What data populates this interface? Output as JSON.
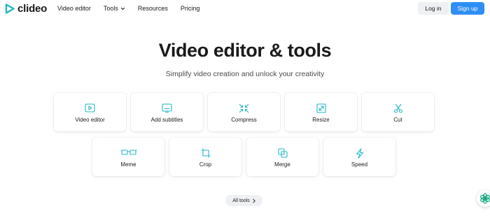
{
  "brand": {
    "name": "clideo",
    "accent": "#2f8ef4",
    "logo_teal": "#22b8c6"
  },
  "nav": {
    "items": [
      {
        "label": "Video editor"
      },
      {
        "label": "Tools",
        "icon": "chevron-down-icon"
      },
      {
        "label": "Resources"
      },
      {
        "label": "Pricing"
      }
    ],
    "login_label": "Log in",
    "signup_label": "Sign up"
  },
  "hero": {
    "title": "Video editor & tools",
    "subtitle": "Simplify video creation and unlock your creativity"
  },
  "tools": [
    {
      "label": "Video editor",
      "icon": "play-icon"
    },
    {
      "label": "Add subtitles",
      "icon": "subtitles-icon"
    },
    {
      "label": "Compress",
      "icon": "compress-icon"
    },
    {
      "label": "Resize",
      "icon": "resize-icon"
    },
    {
      "label": "Cut",
      "icon": "scissors-icon"
    },
    {
      "label": "Meme",
      "icon": "glasses-icon"
    },
    {
      "label": "Crop",
      "icon": "crop-icon"
    },
    {
      "label": "Merge",
      "icon": "merge-icon"
    },
    {
      "label": "Speed",
      "icon": "lightning-icon"
    }
  ],
  "all_tools_label": "All tools",
  "chat_fab": {
    "icon": "chat-assistant-icon"
  }
}
